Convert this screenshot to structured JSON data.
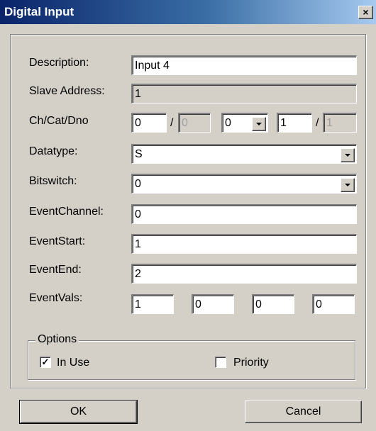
{
  "window": {
    "title": "Digital Input",
    "close_glyph": "×"
  },
  "labels": {
    "description": "Description:",
    "slave_address": "Slave Address:",
    "ch_cat_dno": "Ch/Cat/Dno",
    "datatype": "Datatype:",
    "bitswitch": "Bitswitch:",
    "event_channel": "EventChannel:",
    "event_start": "EventStart:",
    "event_end": "EventEnd:",
    "event_vals": "EventVals:"
  },
  "fields": {
    "description": "Input 4",
    "slave_address": "1",
    "ch": "0",
    "ch_disabled": "0",
    "cat": "0",
    "dno": "1",
    "dno_disabled": "1",
    "datatype": "S",
    "bitswitch": "0",
    "event_channel": "0",
    "event_start": "1",
    "event_end": "2",
    "event_vals": [
      "1",
      "0",
      "0",
      "0"
    ]
  },
  "separator": "/",
  "options": {
    "title": "Options",
    "in_use": {
      "label": "In Use",
      "checked": true,
      "mark": "✓"
    },
    "priority": {
      "label": "Priority",
      "checked": false
    }
  },
  "buttons": {
    "ok": "OK",
    "cancel": "Cancel"
  }
}
